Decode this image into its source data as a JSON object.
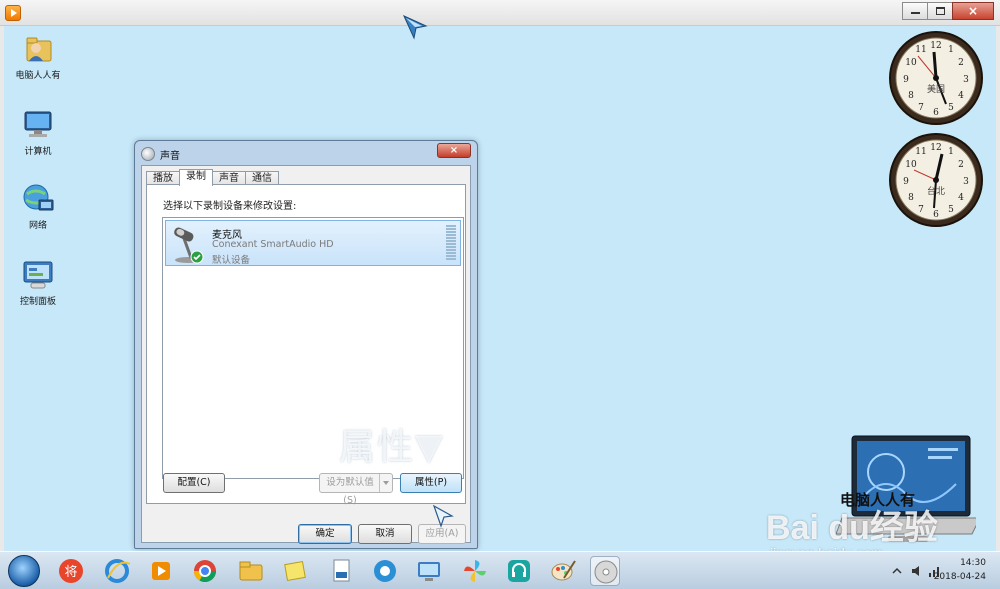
{
  "window": {
    "controls": {
      "minimize": "minimize",
      "maximize": "maximize",
      "close": "×"
    }
  },
  "desktop": {
    "icons": [
      {
        "label": "电脑人人有",
        "icon": "user-folder-icon"
      },
      {
        "label": "计算机",
        "icon": "computer-icon"
      },
      {
        "label": "网络",
        "icon": "network-icon"
      },
      {
        "label": "控制面板",
        "icon": "control-panel-icon"
      }
    ],
    "clocks": [
      {
        "label": "美国"
      },
      {
        "label": "台北"
      }
    ]
  },
  "dialog": {
    "title": "声音",
    "close_label": "×",
    "tabs": [
      {
        "label": "播放",
        "active": false
      },
      {
        "label": "录制",
        "active": true
      },
      {
        "label": "声音",
        "active": false
      },
      {
        "label": "通信",
        "active": false
      }
    ],
    "instruction": "选择以下录制设备来修改设置:",
    "device": {
      "name": "麦克风",
      "driver": "Conexant SmartAudio HD",
      "status": "默认设备"
    },
    "overlay_hint": "属性▼",
    "buttons": {
      "configure": "配置(C)",
      "set_default": "设为默认值(S)",
      "properties": "属性(P)",
      "ok": "确定",
      "cancel": "取消",
      "apply": "应用(A)"
    }
  },
  "watermark": {
    "laptop_caption": "电脑人人有",
    "brand": "Bai du经验",
    "site": "jingyan.baidu.com"
  },
  "taskbar": {
    "time": "14:30",
    "date": "2018-04-24",
    "items": [
      "start-orb",
      "player-app",
      "ie",
      "media",
      "chrome",
      "explorer",
      "sticky-notes",
      "document",
      "browser",
      "display",
      "pinwheel",
      "support",
      "paint",
      "sound-cd"
    ]
  },
  "colors": {
    "desktop": "#c6e8f9",
    "selection": "#cbe4fa",
    "close": "#c8432f"
  }
}
